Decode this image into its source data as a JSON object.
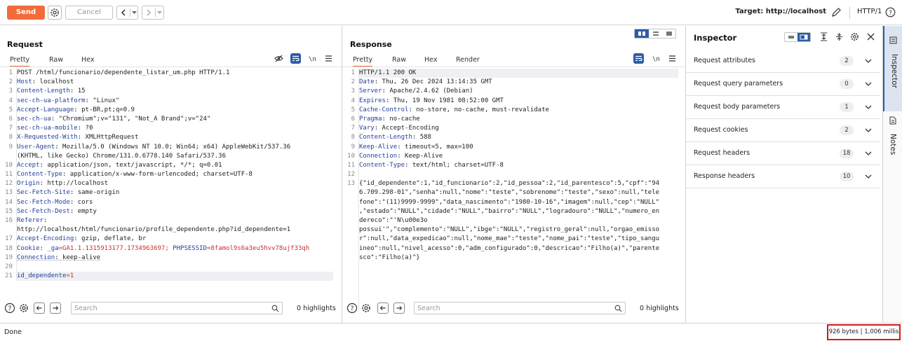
{
  "toolbar": {
    "send_label": "Send",
    "cancel_label": "Cancel",
    "target_label": "Target: http://localhost",
    "http_version": "HTTP/1"
  },
  "request": {
    "title": "Request",
    "tabs": [
      "Pretty",
      "Raw",
      "Hex"
    ],
    "active_tab": "Pretty",
    "highlights": "0 highlights",
    "search_placeholder": "Search",
    "line_numbers": [
      "1",
      "2",
      "3",
      "4",
      "5",
      "6",
      "7",
      "8",
      "9",
      "",
      "10",
      "11",
      "12",
      "13",
      "14",
      "15",
      "16",
      "",
      "17",
      "18",
      "19",
      "20",
      "21"
    ],
    "lines": [
      {
        "key": "",
        "val": "POST /html/funcionario/dependente_listar_um.php HTTP/1.1"
      },
      {
        "key": "Host",
        "val": ": localhost"
      },
      {
        "key": "Content-Length",
        "val": ": 15"
      },
      {
        "key": "sec-ch-ua-platform",
        "val": ": \"Linux\""
      },
      {
        "key": "Accept-Language",
        "val": ": pt-BR,pt;q=0.9"
      },
      {
        "key": "sec-ch-ua",
        "val": ": \"Chromium\";v=\"131\", \"Not_A Brand\";v=\"24\""
      },
      {
        "key": "sec-ch-ua-mobile",
        "val": ": ?0"
      },
      {
        "key": "X-Requested-With",
        "val": ": XMLHttpRequest"
      },
      {
        "key": "User-Agent",
        "val": ": Mozilla/5.0 (Windows NT 10.0; Win64; x64) AppleWebKit/537.36"
      },
      {
        "key": "",
        "val": "(KHTML, like Gecko) Chrome/131.0.6778.140 Safari/537.36"
      },
      {
        "key": "Accept",
        "val": ": application/json, text/javascript, */*; q=0.01"
      },
      {
        "key": "Content-Type",
        "val": ": application/x-www-form-urlencoded; charset=UTF-8"
      },
      {
        "key": "Origin",
        "val": ": http://localhost"
      },
      {
        "key": "Sec-Fetch-Site",
        "val": ": same-origin"
      },
      {
        "key": "Sec-Fetch-Mode",
        "val": ": cors"
      },
      {
        "key": "Sec-Fetch-Dest",
        "val": ": empty"
      },
      {
        "key": "Referer",
        "val": ":"
      },
      {
        "key": "",
        "val": "http://localhost/html/funcionario/profile_dependente.php?id_dependente=1"
      },
      {
        "key": "Accept-Encoding",
        "val": ": gzip, deflate, br"
      }
    ],
    "cookie_line": {
      "key": "Cookie",
      "sep": ": ",
      "name1": "_ga",
      "val1": "=GA1.1.1315913177.1734963697; ",
      "name2": "PHPSESSID",
      "val2": "=8famol9s6a3eu5hvv78ujf33qh"
    },
    "connection_line": {
      "key": "Connection",
      "val": ": keep-alive"
    },
    "body_line": {
      "key": "id_dependente",
      "val": "=1"
    }
  },
  "response": {
    "title": "Response",
    "tabs": [
      "Pretty",
      "Raw",
      "Hex",
      "Render"
    ],
    "active_tab": "Pretty",
    "highlights": "0 highlights",
    "search_placeholder": "Search",
    "line_numbers": [
      "1",
      "2",
      "3",
      "4",
      "5",
      "6",
      "7",
      "8",
      "9",
      "10",
      "11",
      "12",
      "13",
      "",
      "",
      "",
      "",
      "",
      "",
      "",
      "",
      ""
    ],
    "status_line": "HTTP/1.1 200 OK",
    "headers": [
      {
        "key": "Date",
        "val": ": Thu, 26 Dec 2024 13:14:35 GMT"
      },
      {
        "key": "Server",
        "val": ": Apache/2.4.62 (Debian)"
      },
      {
        "key": "Expires",
        "val": ": Thu, 19 Nov 1981 08:52:00 GMT"
      },
      {
        "key": "Cache-Control",
        "val": ": no-store, no-cache, must-revalidate"
      },
      {
        "key": "Pragma",
        "val": ": no-cache"
      },
      {
        "key": "Vary",
        "val": ": Accept-Encoding"
      },
      {
        "key": "Content-Length",
        "val": ": 588"
      },
      {
        "key": "Keep-Alive",
        "val": ": timeout=5, max=100"
      },
      {
        "key": "Connection",
        "val": ": Keep-Alive"
      },
      {
        "key": "Content-Type",
        "val": ": text/html; charset=UTF-8"
      }
    ],
    "body_lines": [
      "{\"id_dependente\":1,\"id_funcionario\":2,\"id_pessoa\":2,\"id_parentesco\":5,\"cpf\":\"94",
      "6.709.298-01\",\"senha\":null,\"nome\":\"teste\",\"sobrenome\":\"teste\",\"sexo\":null,\"tele",
      "fone\":\"(11)9999-9999\",\"data_nascimento\":\"1980-10-16\",\"imagem\":null,\"cep\":\"NULL\"",
      ",\"estado\":\"NULL\",\"cidade\":\"NULL\",\"bairro\":\"NULL\",\"logradouro\":\"NULL\",\"numero_en",
      "dereco\":\"'N\\u00e3o",
      "possui'\",\"complemento\":\"NULL\",\"ibge\":\"NULL\",\"registro_geral\":null,\"orgao_emisso",
      "r\":null,\"data_expedicao\":null,\"nome_mae\":\"teste\",\"nome_pai\":\"teste\",\"tipo_sangu",
      "ineo\":null,\"nivel_acesso\":0,\"adm_configurado\":0,\"descricao\":\"Filho(a)\",\"parente",
      "sco\":\"Filho(a)\"}"
    ]
  },
  "inspector": {
    "title": "Inspector",
    "rows": [
      {
        "label": "Request attributes",
        "count": "2"
      },
      {
        "label": "Request query parameters",
        "count": "0"
      },
      {
        "label": "Request body parameters",
        "count": "1"
      },
      {
        "label": "Request cookies",
        "count": "2"
      },
      {
        "label": "Request headers",
        "count": "18"
      },
      {
        "label": "Response headers",
        "count": "10"
      }
    ],
    "rail": {
      "inspector": "Inspector",
      "notes": "Notes"
    }
  },
  "status": {
    "left": "Done",
    "right": "926 bytes | 1,006 millis"
  },
  "colors": {
    "accent": "#f26b3a",
    "header_key": "#223f9b",
    "cookie_value": "#c93030",
    "highlight_box": "#d11a1a",
    "inspector_tab": "#2a5cab"
  }
}
